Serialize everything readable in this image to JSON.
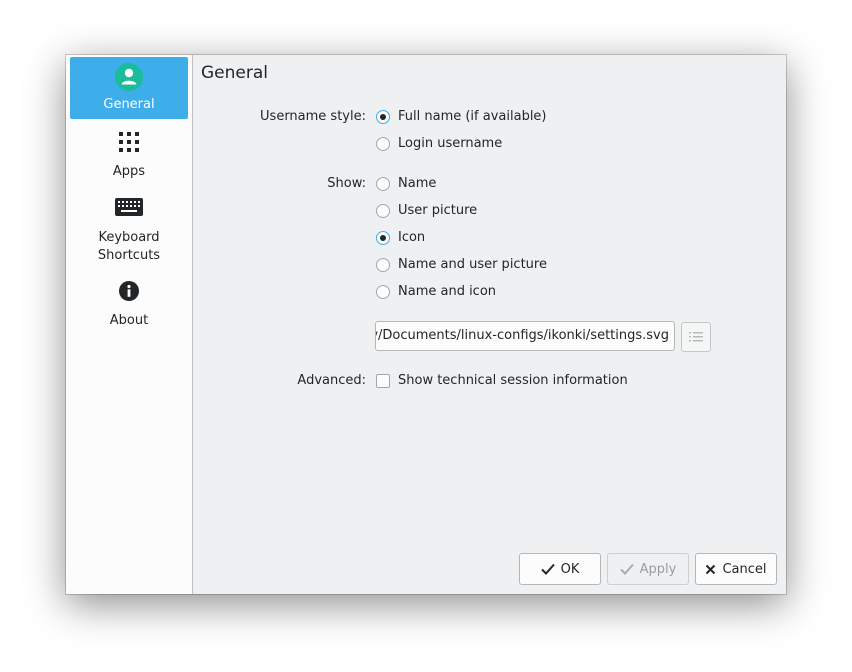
{
  "sidebar": {
    "items": [
      {
        "label": "General",
        "icon": "user-circle-icon",
        "selected": true
      },
      {
        "label": "Apps",
        "icon": "app-grid-icon",
        "selected": false
      },
      {
        "label": "Keyboard\nShortcuts",
        "label_line1": "Keyboard",
        "label_line2": "Shortcuts",
        "icon": "keyboard-icon",
        "selected": false
      },
      {
        "label": "About",
        "icon": "info-icon",
        "selected": false
      }
    ]
  },
  "page": {
    "title": "General"
  },
  "form": {
    "username_style_label": "Username style:",
    "username_options": [
      {
        "label": "Full name (if available)",
        "checked": true
      },
      {
        "label": "Login username",
        "checked": false
      }
    ],
    "show_label": "Show:",
    "show_options": [
      {
        "label": "Name",
        "checked": false
      },
      {
        "label": "User picture",
        "checked": false
      },
      {
        "label": "Icon",
        "checked": true
      },
      {
        "label": "Name and user picture",
        "checked": false
      },
      {
        "label": "Name and icon",
        "checked": false
      }
    ],
    "icon_path_value": "/home/dv/Documents/linux-configs/ikonki/settings.svg",
    "browse_icon": "list-icon",
    "advanced_label": "Advanced:",
    "advanced_option": {
      "label": "Show technical session information",
      "checked": false
    }
  },
  "buttons": {
    "ok": "OK",
    "apply": "Apply",
    "cancel": "Cancel"
  },
  "colors": {
    "accent": "#3daee9",
    "window_bg": "#eff0f1",
    "sidebar_bg": "#fcfcfc"
  }
}
